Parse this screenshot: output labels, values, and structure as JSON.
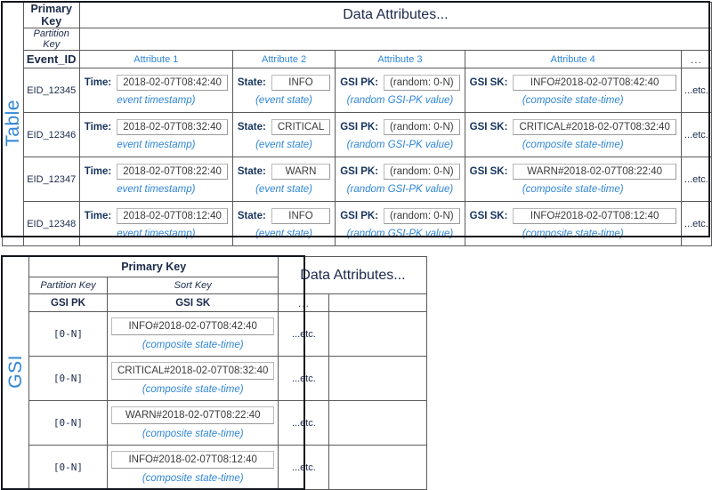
{
  "meta": {
    "colors": {
      "accent_blue": "#2f86d6",
      "header_blue_bg": "#dbe8f6",
      "cell_gray_bg": "#ebebeb",
      "navy_text": "#1b2a4a"
    }
  },
  "table_section": {
    "side_label": "Table",
    "headers": {
      "primary_key": "Primary Key",
      "partition_key": "Partition Key",
      "data_attributes": "Data Attributes..."
    },
    "columns": [
      {
        "label": "Event_ID",
        "kind": "pk"
      },
      {
        "label": "Attribute 1",
        "kind": "attr"
      },
      {
        "label": "Attribute 2",
        "kind": "attr"
      },
      {
        "label": "Attribute 3",
        "kind": "attr"
      },
      {
        "label": "Attribute 4",
        "kind": "attr"
      },
      {
        "label": "...",
        "kind": "dots"
      }
    ],
    "notes": {
      "time": "event timestamp)",
      "state": "(event state)",
      "gsipk": "(random GSI-PK value)",
      "gsisk": "(composite state-time)"
    },
    "keys": {
      "time": "Time:",
      "state": "State:",
      "gsipk": "GSI PK:",
      "gsisk": "GSI SK:"
    },
    "etc": "...etc.",
    "rows": [
      {
        "event_id": "EID_12345",
        "time": "2018-02-07T08:42:40",
        "state": "INFO",
        "gsi_pk": "(random: 0-N)",
        "gsi_sk": "INFO#2018-02-07T08:42:40"
      },
      {
        "event_id": "EID_12346",
        "time": "2018-02-07T08:32:40",
        "state": "CRITICAL",
        "gsi_pk": "(random: 0-N)",
        "gsi_sk": "CRITICAL#2018-02-07T08:32:40"
      },
      {
        "event_id": "EID_12347",
        "time": "2018-02-07T08:22:40",
        "state": "WARN",
        "gsi_pk": "(random: 0-N)",
        "gsi_sk": "WARN#2018-02-07T08:22:40"
      },
      {
        "event_id": "EID_12348",
        "time": "2018-02-07T08:12:40",
        "state": "INFO",
        "gsi_pk": "(random: 0-N)",
        "gsi_sk": "INFO#2018-02-07T08:12:40"
      }
    ]
  },
  "gsi_section": {
    "side_label": "GSI",
    "headers": {
      "primary_key": "Primary Key",
      "partition_key": "Partition Key",
      "sort_key": "Sort Key",
      "data_attributes": "Data Attributes..."
    },
    "columns": [
      {
        "label": "GSI PK",
        "kind": "bold"
      },
      {
        "label": "GSI SK",
        "kind": "bold"
      },
      {
        "label": "...",
        "kind": "dots"
      }
    ],
    "note": "(composite state-time)",
    "etc": "...etc.",
    "rows": [
      {
        "gsi_pk": "[0-N]",
        "gsi_sk": "INFO#2018-02-07T08:42:40"
      },
      {
        "gsi_pk": "[0-N]",
        "gsi_sk": "CRITICAL#2018-02-07T08:32:40"
      },
      {
        "gsi_pk": "[0-N]",
        "gsi_sk": "WARN#2018-02-07T08:22:40"
      },
      {
        "gsi_pk": "[0-N]",
        "gsi_sk": "INFO#2018-02-07T08:12:40"
      }
    ]
  }
}
